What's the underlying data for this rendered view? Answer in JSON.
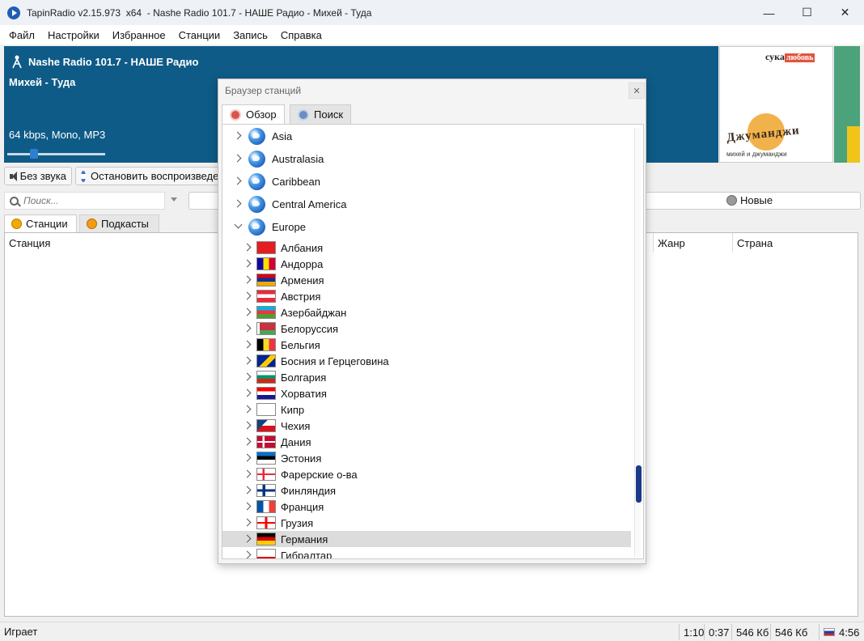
{
  "window": {
    "title": "TapinRadio v2.15.973  x64  - Nashe Radio 101.7 - НАШЕ Радио - Михей - Туда",
    "controls": {
      "minimize": "—",
      "maximize": "☐",
      "close": "✕"
    }
  },
  "menu": [
    "Файл",
    "Настройки",
    "Избранное",
    "Станции",
    "Запись",
    "Справка"
  ],
  "now_playing": {
    "station": "Nashe Radio 101.7 - НАШЕ Радио",
    "track": "Михей - Туда",
    "format": "64 kbps, Mono, MP3",
    "volume_fraction": 0.25,
    "album_art_label_black": "сука",
    "album_art_label_red": "любовь",
    "album_art_logo": "Джуманджи",
    "album_art_sub": "михей и джуманджи"
  },
  "vu_meter": {
    "left_level": 0.0,
    "right_level": 0.31
  },
  "toolbar": {
    "mute_label": "Без звука",
    "stop_label": "Остановить воспроизведение"
  },
  "search": {
    "placeholder": "Поиск...",
    "new_label": "Новые"
  },
  "tabs": {
    "stations": "Станции",
    "podcasts": "Подкасты"
  },
  "table": {
    "columns": [
      "Станция",
      "Жанр",
      "Страна"
    ]
  },
  "status": {
    "state": "Играет",
    "elapsed": "1:10",
    "duration": "0:37",
    "size_a": "546 Кб",
    "size_b": "546 Кб",
    "clock": "4:56"
  },
  "browser": {
    "title": "Браузер станций",
    "tab_overview": "Обзор",
    "tab_search": "Поиск",
    "regions": [
      {
        "name": "Asia",
        "expanded": false
      },
      {
        "name": "Australasia",
        "expanded": false
      },
      {
        "name": "Caribbean",
        "expanded": false
      },
      {
        "name": "Central America",
        "expanded": false
      },
      {
        "name": "Europe",
        "expanded": true
      }
    ],
    "countries": [
      {
        "name": "Албания",
        "flag": "albania"
      },
      {
        "name": "Андорра",
        "flag": "andorra"
      },
      {
        "name": "Армения",
        "flag": "armenia"
      },
      {
        "name": "Австрия",
        "flag": "austria"
      },
      {
        "name": "Азербайджан",
        "flag": "azerbaijan"
      },
      {
        "name": "Белоруссия",
        "flag": "belarus"
      },
      {
        "name": "Бельгия",
        "flag": "belgium"
      },
      {
        "name": "Босния и Герцеговина",
        "flag": "bosnia"
      },
      {
        "name": "Болгария",
        "flag": "bulgaria"
      },
      {
        "name": "Хорватия",
        "flag": "croatia"
      },
      {
        "name": "Кипр",
        "flag": "cyprus"
      },
      {
        "name": "Чехия",
        "flag": "czech"
      },
      {
        "name": "Дания",
        "flag": "denmark"
      },
      {
        "name": "Эстония",
        "flag": "estonia"
      },
      {
        "name": "Фарерские о-ва",
        "flag": "faroe"
      },
      {
        "name": "Финляндия",
        "flag": "finland"
      },
      {
        "name": "Франция",
        "flag": "france"
      },
      {
        "name": "Грузия",
        "flag": "georgia"
      },
      {
        "name": "Германия",
        "flag": "germany",
        "selected": true
      },
      {
        "name": "Гибралтар",
        "flag": "gibraltar"
      }
    ]
  },
  "colors": {
    "nowplaying_bg": "#0f5b87",
    "vu_green": "#4ca27a",
    "vu_yellow": "#f0c419",
    "selection": "#dcdcdc",
    "scroll_thumb": "#1c3a8a"
  }
}
